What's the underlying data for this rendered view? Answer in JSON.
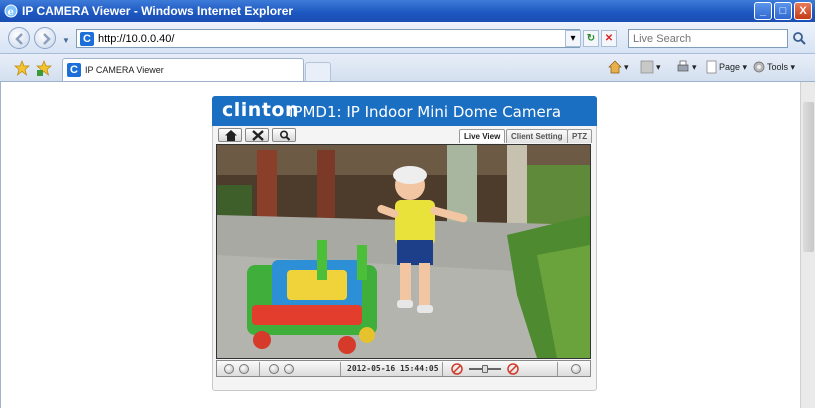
{
  "window": {
    "title": "IP CAMERA Viewer - Windows Internet Explorer",
    "minimize_label": "_",
    "maximize_label": "□",
    "close_label": "X"
  },
  "address_bar": {
    "url": "http://10.0.0.40/",
    "search_placeholder": "Live Search"
  },
  "tabs": [
    {
      "label": "IP CAMERA Viewer",
      "active": true
    }
  ],
  "command_bar": {
    "page_label": "Page",
    "tools_label": "Tools"
  },
  "camera": {
    "brand": "clinton",
    "model_title": "IPMD1: IP Indoor Mini Dome Camera",
    "view_tabs": [
      "Live View",
      "Client Setting",
      "PTZ"
    ],
    "active_view_tab": "Live View",
    "timestamp": "2012-05-16 15:44:05"
  },
  "colors": {
    "banner": "#1a6fc2",
    "titlebar": "#1c56c0"
  }
}
